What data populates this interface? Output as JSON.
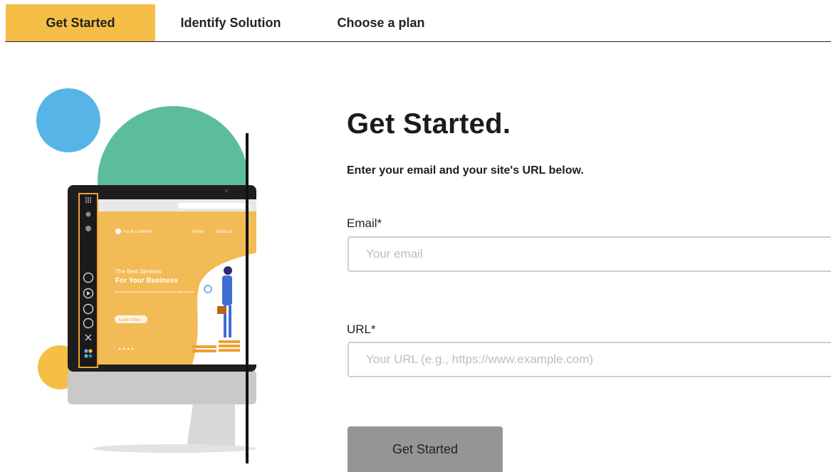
{
  "tabs": [
    {
      "label": "Get Started",
      "active": true
    },
    {
      "label": "Identify Solution",
      "active": false
    },
    {
      "label": "Choose a plan",
      "active": false
    }
  ],
  "illustration": {
    "company": "YOUR COMPANY",
    "nav": [
      "Home",
      "About us"
    ],
    "hero_line1": "The Best Services",
    "hero_line2": "For Your Business",
    "hero_body": "We look forward to partnering with you in your journey towards growth.",
    "cta": "Learn More",
    "toolbar_icons": [
      "grid-icon",
      "gear-icon",
      "help-icon",
      "apps-icon",
      "play-icon",
      "move-icon",
      "info-icon",
      "close-icon",
      "palette-icon"
    ]
  },
  "main": {
    "title": "Get Started.",
    "subtitle": "Enter your email and your site's URL below.",
    "email_label": "Email*",
    "email_placeholder": "Your email",
    "url_label": "URL*",
    "url_placeholder": "Your URL (e.g., https://www.example.com)",
    "submit_label": "Get Started"
  },
  "colors": {
    "accent": "#f5bf47",
    "blue_circle": "#56b5e6",
    "green_circle": "#5bbd9b",
    "button_bg": "#959595",
    "toolbar_border": "#f0a035"
  }
}
